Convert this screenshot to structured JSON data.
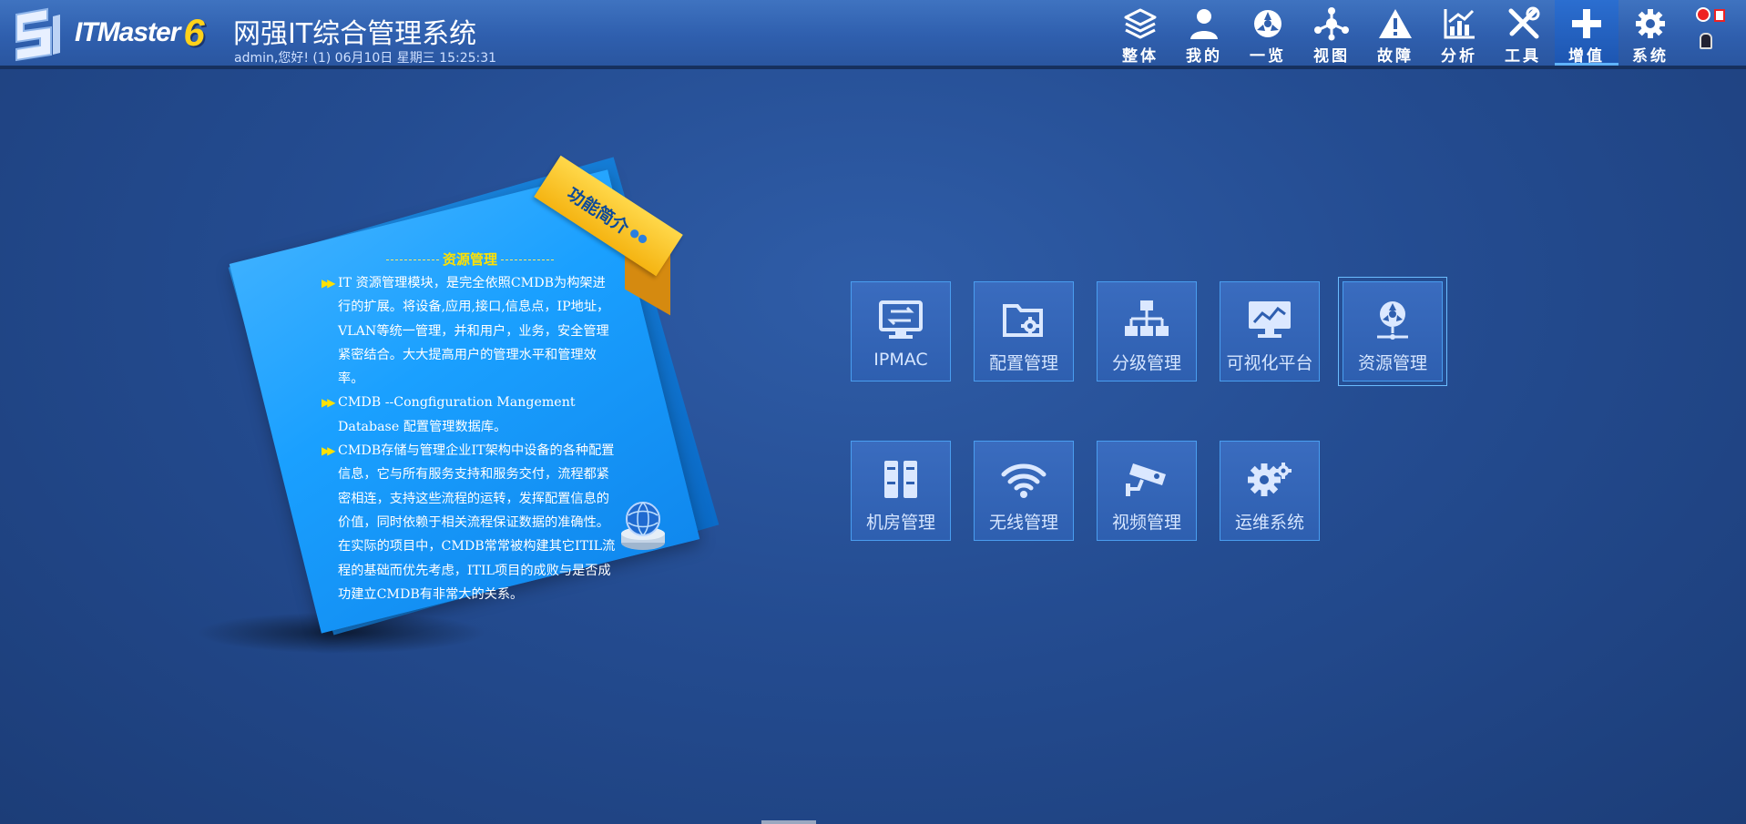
{
  "header": {
    "brand": "ITMaster",
    "brand_version": "6",
    "app_title": "网强IT综合管理系统",
    "user_info": "admin,您好! (1) 06月10日 星期三 15:25:31"
  },
  "nav": [
    {
      "label": "整体",
      "icon": "layers-icon"
    },
    {
      "label": "我的",
      "icon": "user-icon"
    },
    {
      "label": "一览",
      "icon": "overview-icon"
    },
    {
      "label": "视图",
      "icon": "topology-icon"
    },
    {
      "label": "故障",
      "icon": "warning-icon"
    },
    {
      "label": "分析",
      "icon": "chart-icon"
    },
    {
      "label": "工具",
      "icon": "tools-icon"
    },
    {
      "label": "增值",
      "icon": "plus-icon",
      "active": true
    },
    {
      "label": "系统",
      "icon": "gear-icon"
    }
  ],
  "feature_card": {
    "ribbon": "功能简介",
    "title": "资源管理",
    "paragraphs": [
      "IT 资源管理模块，是完全依照CMDB为构架进行的扩展。将设备,应用,接口,信息点，IP地址，VLAN等统一管理，并和用户，业务，安全管理紧密结合。大大提高用户的管理水平和管理效率。",
      "CMDB --Congfiguration Mangement Database 配置管理数据库。",
      "CMDB存储与管理企业IT架构中设备的各种配置信息，它与所有服务支持和服务交付，流程都紧密相连，支持这些流程的运转，发挥配置信息的价值，同时依赖于相关流程保证数据的准确性。在实际的项目中，CMDB常常被构建其它ITIL流程的基础而优先考虑，ITIL项目的成败与是否成功建立CMDB有非常大的关系。"
    ]
  },
  "modules": [
    {
      "label": "IPMAC",
      "icon": "monitor-ip-icon"
    },
    {
      "label": "配置管理",
      "icon": "folder-gear-icon"
    },
    {
      "label": "分级管理",
      "icon": "hierarchy-icon"
    },
    {
      "label": "可视化平台",
      "icon": "monitor-chart-icon"
    },
    {
      "label": "资源管理",
      "icon": "resource-globe-icon",
      "active": true
    },
    {
      "label": "机房管理",
      "icon": "server-rack-icon"
    },
    {
      "label": "无线管理",
      "icon": "wifi-icon"
    },
    {
      "label": "视频管理",
      "icon": "camera-icon"
    },
    {
      "label": "运维系统",
      "icon": "gears-icon"
    }
  ],
  "colors": {
    "background": "#244c91",
    "header": "#2f5fae",
    "card": "#1aa0ff",
    "ribbon": "#f5b412",
    "accent_text": "#ffe100"
  }
}
